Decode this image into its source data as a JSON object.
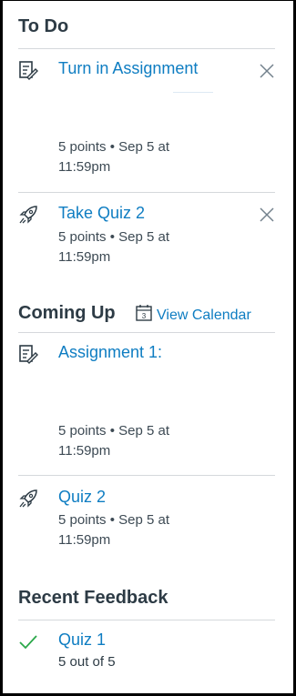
{
  "todo": {
    "title": "To Do",
    "items": [
      {
        "icon": "assignment-icon",
        "title": "Turn in Assignment",
        "points": "5 points",
        "due": "Sep 5 at 11:59pm"
      },
      {
        "icon": "quiz-rocket-icon",
        "title": "Take Quiz 2",
        "points": "5 points",
        "due": "Sep 5 at 11:59pm"
      }
    ]
  },
  "coming_up": {
    "title": "Coming Up",
    "view_calendar_label": "View Calendar",
    "calendar_day": "3",
    "items": [
      {
        "icon": "assignment-icon",
        "title": "Assignment 1:",
        "points": "5 points",
        "due": "Sep 5 at 11:59pm"
      },
      {
        "icon": "quiz-rocket-icon",
        "title": "Quiz 2",
        "points": "5 points",
        "due": "Sep 5 at 11:59pm"
      }
    ]
  },
  "recent_feedback": {
    "title": "Recent Feedback",
    "items": [
      {
        "icon": "checkmark-icon",
        "title": "Quiz 1",
        "score": "5 out of 5"
      }
    ]
  },
  "colors": {
    "link": "#0e7dc2",
    "check": "#2ba84a",
    "text": "#2d3b45"
  }
}
